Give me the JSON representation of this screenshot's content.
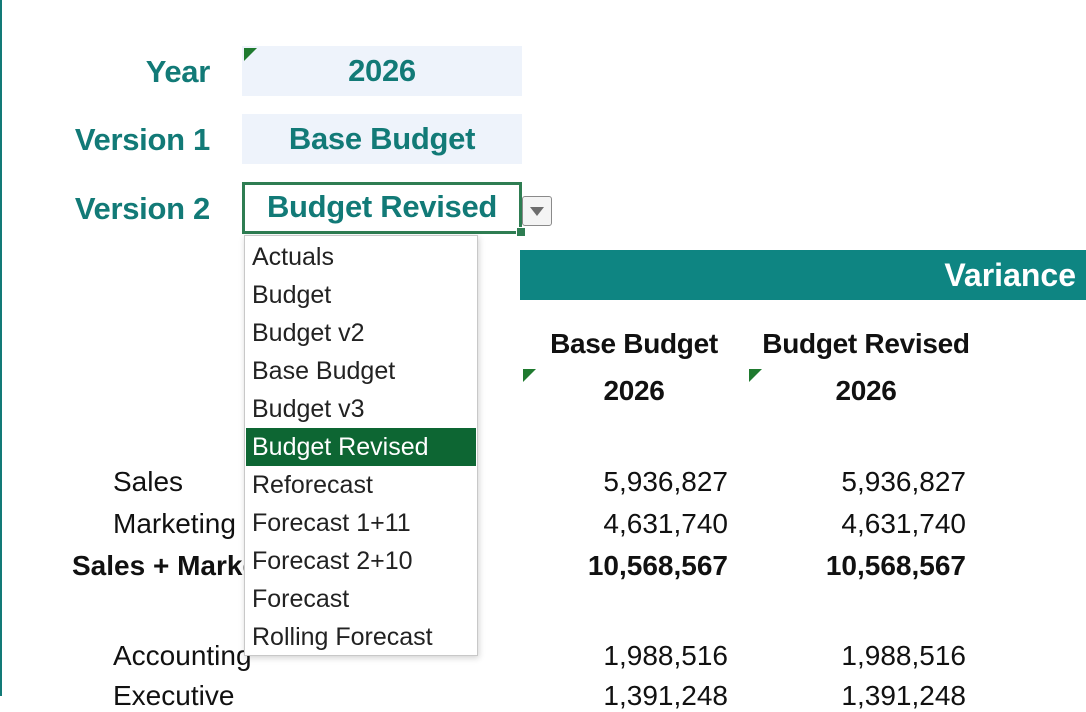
{
  "params": {
    "year": {
      "label": "Year",
      "value": "2026"
    },
    "version1": {
      "label": "Version 1",
      "value": "Base Budget"
    },
    "version2": {
      "label": "Version 2",
      "value": "Budget Revised"
    }
  },
  "dropdown": {
    "options": [
      "Actuals",
      "Budget",
      "Budget v2",
      "Base Budget",
      "Budget v3",
      "Budget Revised",
      "Reforecast",
      "Forecast 1+11",
      "Forecast 2+10",
      "Forecast",
      "Rolling Forecast"
    ],
    "selected": "Budget Revised"
  },
  "table": {
    "banner": "Variance",
    "columns": [
      {
        "version": "Base Budget",
        "year": "2026"
      },
      {
        "version": "Budget Revised",
        "year": "2026"
      }
    ],
    "rows": [
      {
        "label": "Sales",
        "values": [
          "5,936,827",
          "5,936,827"
        ],
        "bold": false
      },
      {
        "label": "Marketing",
        "values": [
          "4,631,740",
          "4,631,740"
        ],
        "bold": false
      },
      {
        "label": "Sales + Marketing",
        "values": [
          "10,568,567",
          "10,568,567"
        ],
        "bold": true
      },
      {
        "label": "Accounting",
        "values": [
          "1,988,516",
          "1,988,516"
        ],
        "bold": false
      },
      {
        "label": "Executive",
        "values": [
          "1,391,248",
          "1,391,248"
        ],
        "bold": false
      }
    ]
  },
  "colors": {
    "accent": "#127a77",
    "banner": "#0e8582",
    "selection": "#0d6633",
    "cell_fill": "#eef3fb"
  }
}
